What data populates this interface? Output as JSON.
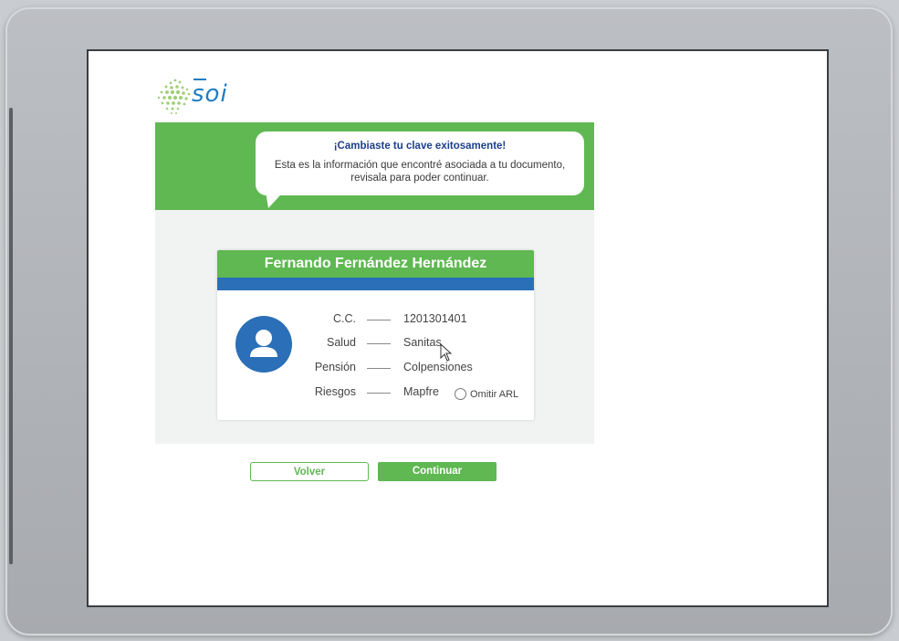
{
  "logo": {
    "text": "soi"
  },
  "message": {
    "title": "¡Cambiaste tu clave exitosamente!",
    "body": "Esta es la información que encontré asociada a tu documento, revisala para poder continuar."
  },
  "card": {
    "name": "Fernando Fernández Hernández",
    "avatar_icon": "user-icon",
    "fields": [
      {
        "label": "C.C.",
        "value": "1201301401"
      },
      {
        "label": "Salud",
        "value": "Sanitas"
      },
      {
        "label": "Pensión",
        "value": "Colpensiones"
      },
      {
        "label": "Riesgos",
        "value": "Mapfre"
      }
    ],
    "omit_arl_label": "Omitir ARL"
  },
  "buttons": {
    "back": "Volver",
    "continue": "Continuar"
  },
  "colors": {
    "green": "#5fb852",
    "blue": "#2a6fb7",
    "title_blue": "#1d3f8a"
  }
}
